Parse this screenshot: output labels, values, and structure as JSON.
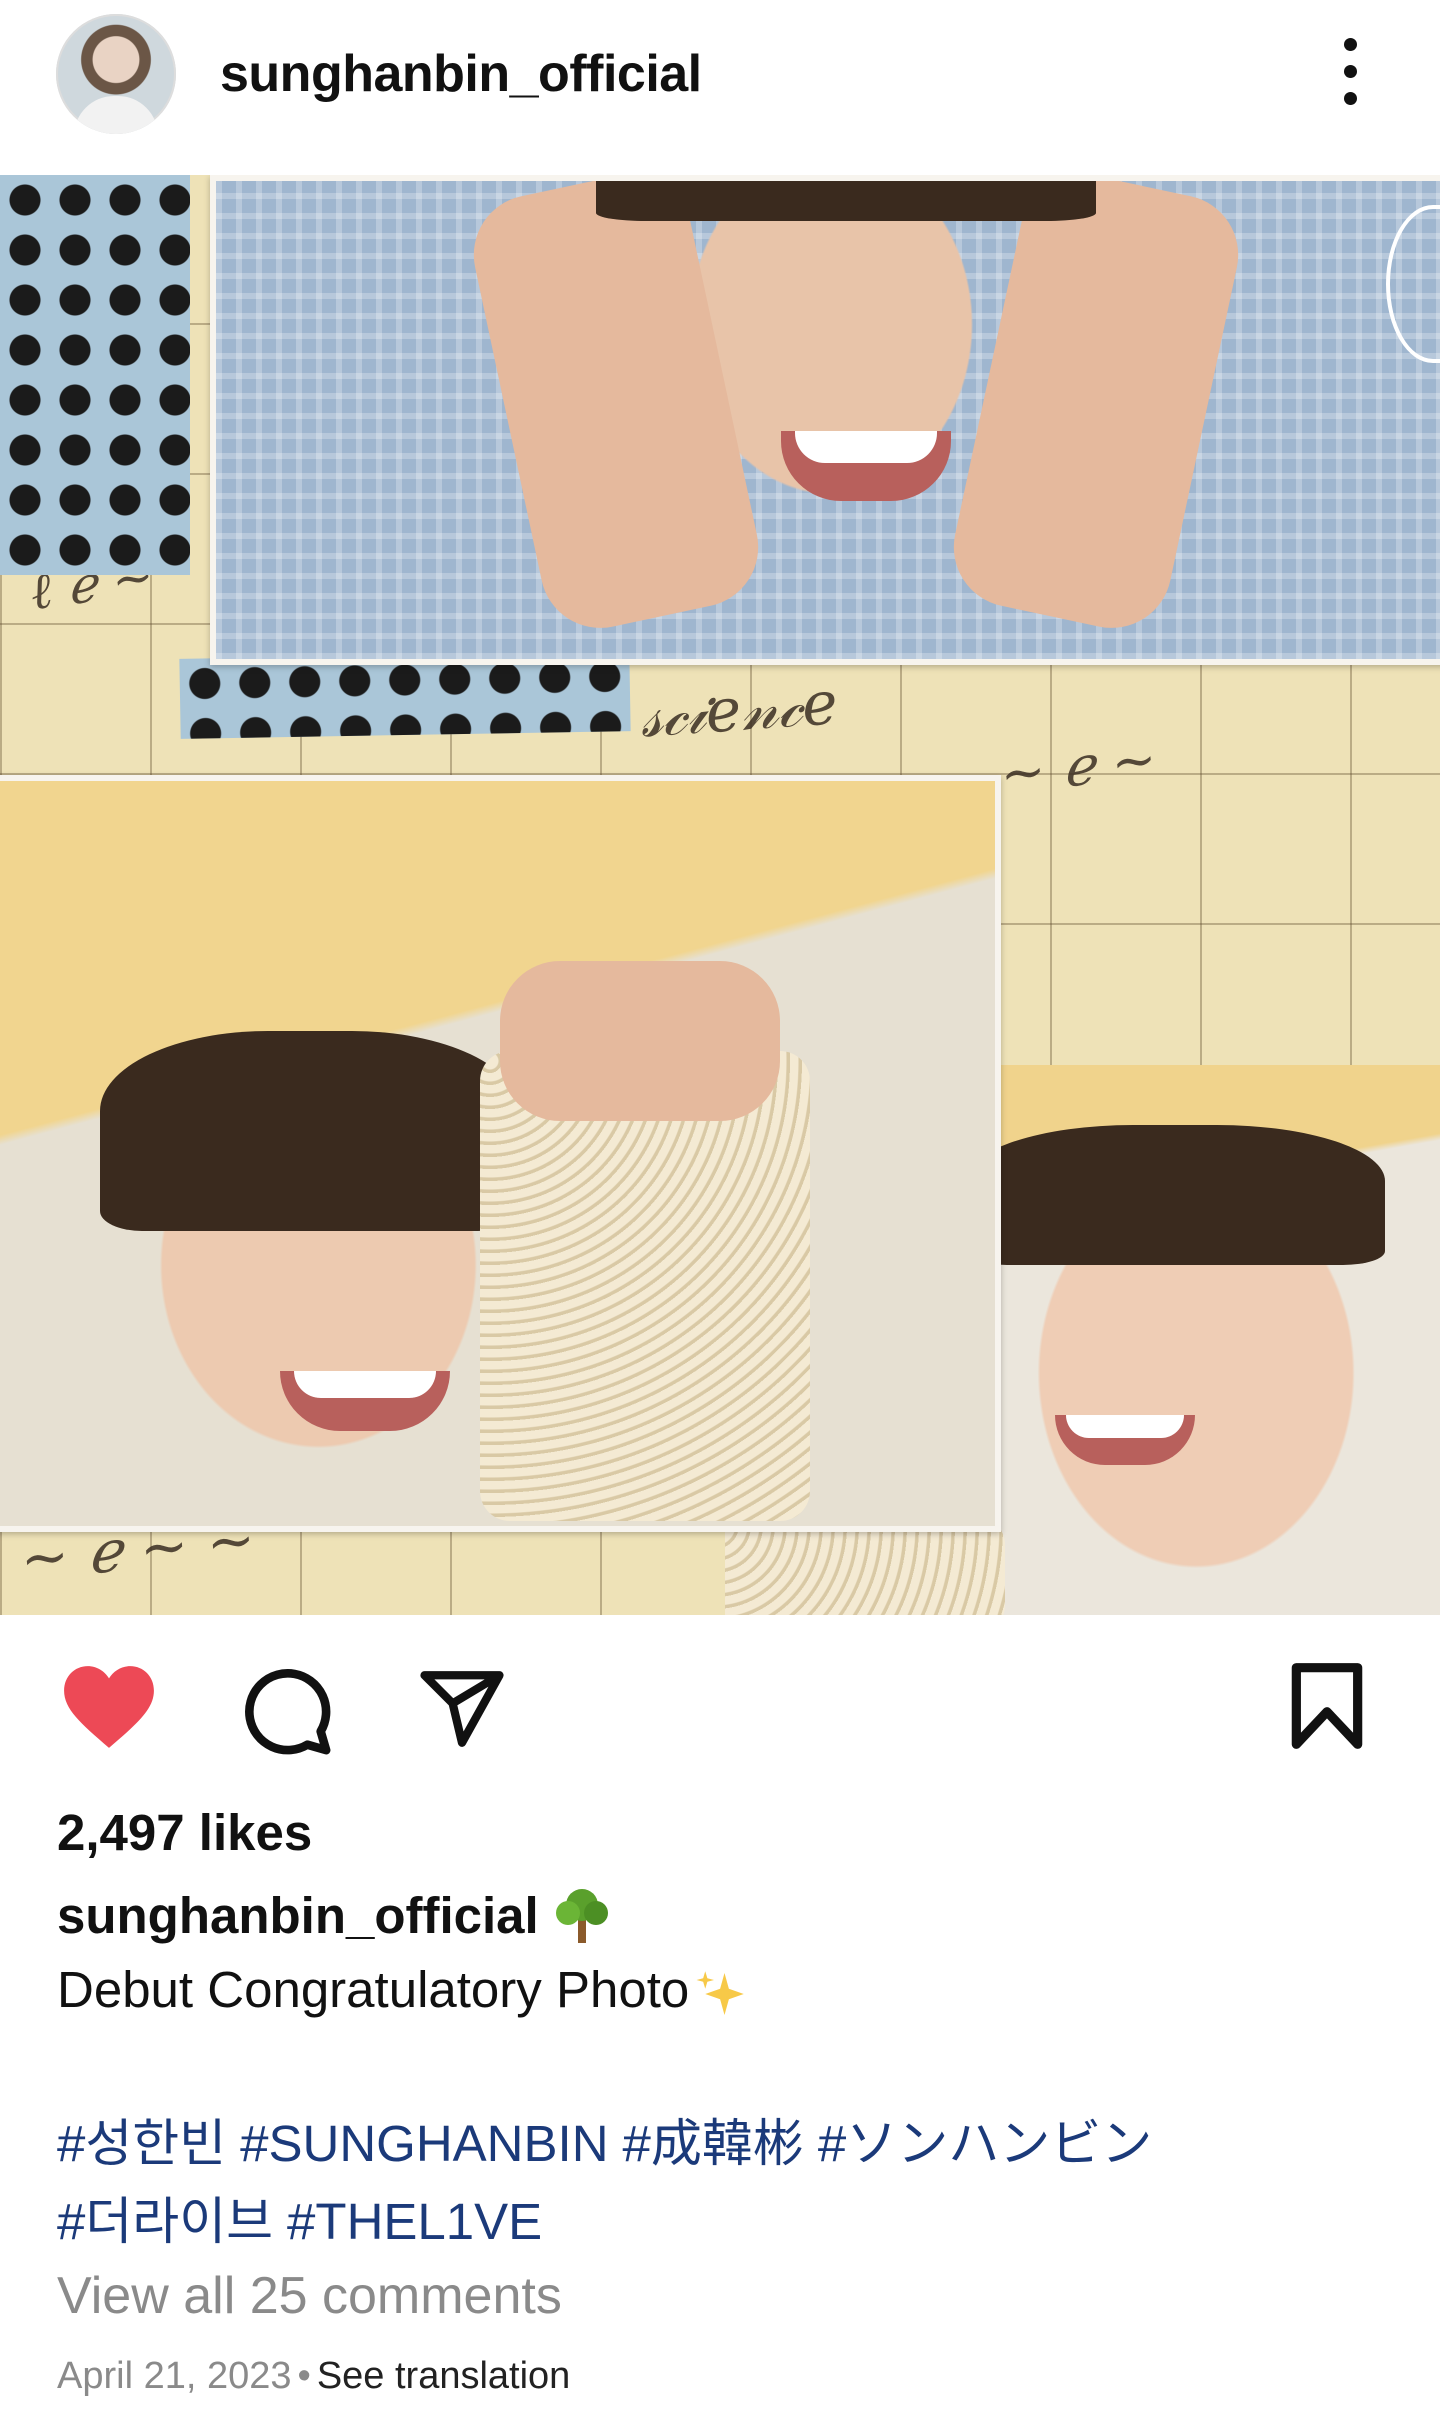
{
  "header": {
    "username": "sunghanbin_official",
    "avatar_icon": "profile-avatar",
    "menu_icon": "more-vertical-icon"
  },
  "post_image": {
    "description_icon": "photo-collage"
  },
  "actions": {
    "like_icon": "heart-filled-icon",
    "like_color": "#ed4956",
    "comment_icon": "comment-icon",
    "share_icon": "send-icon",
    "save_icon": "bookmark-icon"
  },
  "post": {
    "likes": "2,497 likes",
    "author": "sunghanbin_official",
    "author_emoji": "tree-emoji",
    "caption": "Debut Congratulatory Photo",
    "caption_emoji": "sparkles-emoji",
    "hashtags": [
      "#성한빈",
      "#SUNGHANBIN",
      "#成韓彬",
      "#ソンハンビン",
      "#더라이브",
      "#THEL1VE"
    ],
    "hashtag_color": "#1b3a7a",
    "view_comments": "View all 25 comments",
    "date": "April 21, 2023",
    "separator": "•",
    "see_translation": "See translation"
  }
}
